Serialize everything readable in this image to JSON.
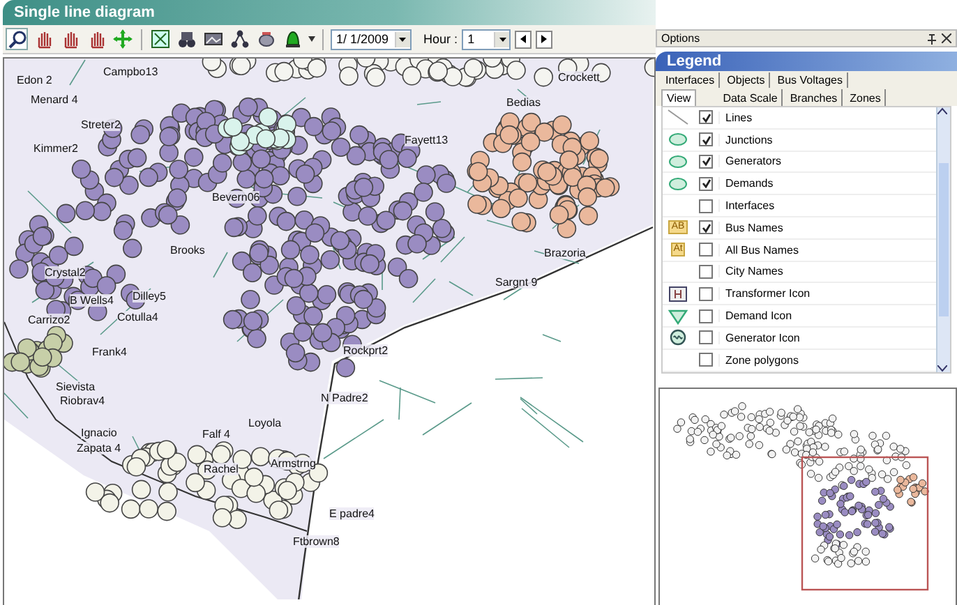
{
  "window": {
    "title": "Single line diagram"
  },
  "toolbar": {
    "tools": [
      {
        "kind": "zoom",
        "selected": true
      },
      {
        "kind": "hand",
        "selected": false
      },
      {
        "kind": "hand",
        "selected": false
      },
      {
        "kind": "hand",
        "selected": false
      },
      {
        "kind": "move",
        "selected": false
      },
      {
        "kind": "fit",
        "selected": false
      },
      {
        "kind": "binoculars",
        "selected": false
      },
      {
        "kind": "image",
        "selected": false
      },
      {
        "kind": "network",
        "selected": false
      },
      {
        "kind": "cup",
        "selected": false
      },
      {
        "kind": "bell",
        "selected": false
      }
    ],
    "date": "1/ 1/2009",
    "hour_label": "Hour :",
    "hour": "1"
  },
  "map": {
    "bus_names": [
      "Campbo13",
      "Edon 2",
      "Menard 4",
      "Streter2",
      "Kimmer2",
      "Bevern06",
      "Brooks",
      "Crystal2",
      "B Wells4",
      "Dilley5",
      "Cotulla4",
      "Carrizo2",
      "Crockett",
      "Bedias",
      "Fayett13",
      "Brazoria",
      "Sargnt 9",
      "Frank4",
      "Sievista",
      "Riobrav4",
      "Ignacio",
      "Zapata 4",
      "Falf 4",
      "Loyola",
      "Rachel",
      "Armstrng",
      "Rockprt2",
      "N Padre2",
      "E padre4",
      "Ftbrown8"
    ]
  },
  "options": {
    "title": "Options",
    "legend_title": "Legend",
    "tabs": [
      [
        {
          "label": "Interfaces",
          "selected": false
        },
        {
          "label": "Objects",
          "selected": false
        },
        {
          "label": "Bus Voltages",
          "selected": false
        }
      ],
      [
        {
          "label": "View",
          "selected": true
        },
        {
          "label": "Data Scale",
          "selected": false
        },
        {
          "label": "Branches",
          "selected": false
        },
        {
          "label": "Zones",
          "selected": false
        }
      ]
    ],
    "rows": [
      {
        "kind": "line",
        "checked": true,
        "label": "Lines"
      },
      {
        "kind": "circle",
        "checked": true,
        "label": "Junctions"
      },
      {
        "kind": "circle",
        "checked": true,
        "label": "Generators"
      },
      {
        "kind": "circle",
        "checked": true,
        "label": "Demands"
      },
      {
        "kind": "none",
        "checked": false,
        "label": "Interfaces"
      },
      {
        "kind": "text",
        "icon_label": "AB",
        "checked": true,
        "label": "Bus Names"
      },
      {
        "kind": "text",
        "icon_label": "At",
        "checked": false,
        "label": "All Bus Names"
      },
      {
        "kind": "none",
        "checked": false,
        "label": "City Names"
      },
      {
        "kind": "transformer",
        "checked": false,
        "label": "Transformer Icon"
      },
      {
        "kind": "demand",
        "checked": false,
        "label": "Demand Icon"
      },
      {
        "kind": "generator",
        "checked": false,
        "label": "Generator Icon"
      },
      {
        "kind": "none",
        "checked": false,
        "label": "Zone polygons"
      }
    ]
  }
}
